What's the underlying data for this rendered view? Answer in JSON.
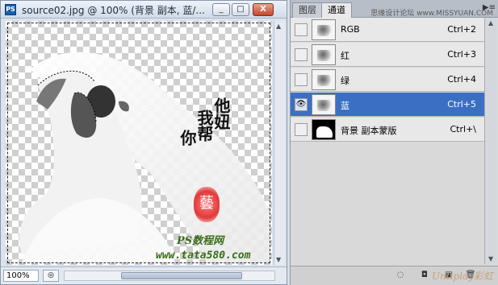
{
  "document": {
    "app_icon": "PS",
    "title": "source02.jpg @ 100% (背景 副本, 蓝/...",
    "window_buttons": {
      "minimize": "_",
      "maximize": "□",
      "close": "X"
    },
    "zoom": "100%",
    "status_icon": "◎",
    "image_text": {
      "calligraphy_col1": "他妞",
      "calligraphy_col2": "我帮",
      "calligraphy_col3": "你",
      "seal": "藝",
      "site_name": "PS数程网",
      "site_url": "www.tata580.com"
    }
  },
  "channels_panel": {
    "tabs": [
      {
        "label": "图层"
      },
      {
        "label": "通道"
      }
    ],
    "active_tab": "通道",
    "menu_icon": "▶≡",
    "channels": [
      {
        "name": "RGB",
        "shortcut": "Ctrl+2",
        "visible": false,
        "selected": false,
        "thumb": "figure"
      },
      {
        "name": "红",
        "shortcut": "Ctrl+3",
        "visible": false,
        "selected": false,
        "thumb": "figure"
      },
      {
        "name": "绿",
        "shortcut": "Ctrl+4",
        "visible": false,
        "selected": false,
        "thumb": "figure"
      },
      {
        "name": "蓝",
        "shortcut": "Ctrl+5",
        "visible": true,
        "selected": true,
        "thumb": "figure"
      },
      {
        "name": "背景 副本蒙版",
        "shortcut": "Ctrl+\\",
        "visible": false,
        "selected": false,
        "thumb": "mask"
      }
    ],
    "eye_glyph": "👁",
    "footer_buttons": {
      "load_selection": "◌",
      "save_selection": "◘",
      "new_channel": "▣",
      "delete_channel": "🗑"
    }
  },
  "watermarks": {
    "top": "思缘设计论坛 www.MISSYUAN.COM",
    "bottom": "Untiplay彩虹"
  },
  "colors": {
    "selection": "#3a6fc4",
    "panel_bg": "#d9d9d9",
    "close_btn": "#c5452b"
  }
}
